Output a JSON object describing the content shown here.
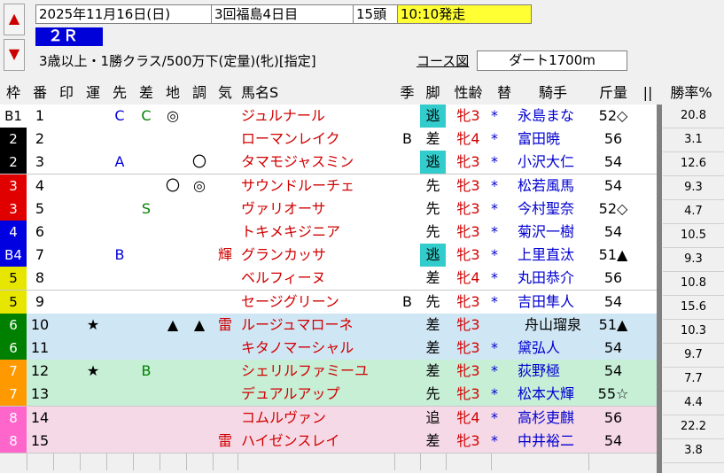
{
  "header": {
    "date": "2025年11月16日(日)",
    "meeting": "3回福島4日目",
    "field_size": "15頭",
    "post_time": "10:10発走",
    "race_number": "２Ｒ",
    "conditions": "3歳以上・1勝クラス/500万下(定量)(牝)[指定]",
    "course_link": "コース図",
    "course": "ダート1700m",
    "up_arrow": "▲",
    "down_arrow": "▼"
  },
  "columns": [
    "枠",
    "番",
    "印",
    "運",
    "先",
    "差",
    "地",
    "調",
    "気",
    "馬名S",
    "季",
    "脚",
    "性齢",
    "替",
    "騎手",
    "斤量",
    "||",
    "勝率%"
  ],
  "colors": {
    "waku": [
      "#ffffff",
      "#000000",
      "#e00000",
      "#0000e0",
      "#e6e600",
      "#008000",
      "#ff9900",
      "#ff66cc"
    ],
    "highlight_cyan": "#33cccc",
    "row_blue": "#cfe6f4",
    "row_green": "#c6efd6",
    "row_pink": "#f6d9e6"
  },
  "horses": [
    {
      "waku": "B1",
      "num": "1",
      "in": "",
      "un": "",
      "saki": "C",
      "sa": "C",
      "chi": "◎",
      "cho": "",
      "ki": "",
      "name": "ジュルナール",
      "kisetsu": "",
      "kyaku": "逃",
      "sexage": "牝3",
      "kae": "*",
      "jockey": "永島まな",
      "weight": "52◇",
      "odds": "20.8"
    },
    {
      "waku": "2",
      "num": "2",
      "in": "",
      "un": "",
      "saki": "",
      "sa": "",
      "chi": "",
      "cho": "",
      "ki": "",
      "name": "ローマンレイク",
      "kisetsu": "B",
      "kyaku": "差",
      "sexage": "牝4",
      "kae": "*",
      "jockey": "富田暁",
      "weight": "56",
      "odds": "3.1"
    },
    {
      "waku": "2",
      "num": "3",
      "in": "",
      "un": "",
      "saki": "A",
      "sa": "",
      "chi": "",
      "cho": "〇",
      "ki": "",
      "name": "タマモジャスミン",
      "kisetsu": "",
      "kyaku": "逃",
      "sexage": "牝3",
      "kae": "*",
      "jockey": "小沢大仁",
      "weight": "54",
      "odds": "12.6"
    },
    {
      "waku": "3",
      "num": "4",
      "in": "",
      "un": "",
      "saki": "",
      "sa": "",
      "chi": "〇",
      "cho": "◎",
      "ki": "",
      "name": "サウンドルーチェ",
      "kisetsu": "",
      "kyaku": "先",
      "sexage": "牝3",
      "kae": "*",
      "jockey": "松若風馬",
      "weight": "54",
      "odds": "9.3"
    },
    {
      "waku": "3",
      "num": "5",
      "in": "",
      "un": "",
      "saki": "",
      "sa": "S",
      "chi": "",
      "cho": "",
      "ki": "",
      "name": "ヴァリオーサ",
      "kisetsu": "",
      "kyaku": "先",
      "sexage": "牝3",
      "kae": "*",
      "jockey": "今村聖奈",
      "weight": "52◇",
      "odds": "4.7"
    },
    {
      "waku": "4",
      "num": "6",
      "in": "",
      "un": "",
      "saki": "",
      "sa": "",
      "chi": "",
      "cho": "",
      "ki": "",
      "name": "トキメキジニア",
      "kisetsu": "",
      "kyaku": "先",
      "sexage": "牝3",
      "kae": "*",
      "jockey": "菊沢一樹",
      "weight": "54",
      "odds": "10.5"
    },
    {
      "waku": "B4",
      "num": "7",
      "in": "",
      "un": "",
      "saki": "B",
      "sa": "",
      "chi": "",
      "cho": "",
      "ki": "輝",
      "name": "グランカッサ",
      "kisetsu": "",
      "kyaku": "逃",
      "sexage": "牝3",
      "kae": "*",
      "jockey": "上里直汰",
      "weight": "51▲",
      "odds": "9.3"
    },
    {
      "waku": "5",
      "num": "8",
      "in": "",
      "un": "",
      "saki": "",
      "sa": "",
      "chi": "",
      "cho": "",
      "ki": "",
      "name": "ベルフィーヌ",
      "kisetsu": "",
      "kyaku": "差",
      "sexage": "牝4",
      "kae": "*",
      "jockey": "丸田恭介",
      "weight": "56",
      "odds": "10.8"
    },
    {
      "waku": "5",
      "num": "9",
      "in": "",
      "un": "",
      "saki": "",
      "sa": "",
      "chi": "",
      "cho": "",
      "ki": "",
      "name": "セージグリーン",
      "kisetsu": "B",
      "kyaku": "先",
      "sexage": "牝3",
      "kae": "*",
      "jockey": "吉田隼人",
      "weight": "54",
      "odds": "15.6"
    },
    {
      "waku": "6",
      "num": "10",
      "in": "",
      "un": "★",
      "saki": "",
      "sa": "",
      "chi": "▲",
      "cho": "▲",
      "ki": "雷",
      "name": "ルージュマローネ",
      "kisetsu": "",
      "kyaku": "差",
      "sexage": "牝3",
      "kae": "",
      "jockey": "舟山瑠泉",
      "weight": "51▲",
      "odds": "10.3"
    },
    {
      "waku": "6",
      "num": "11",
      "in": "",
      "un": "",
      "saki": "",
      "sa": "",
      "chi": "",
      "cho": "",
      "ki": "",
      "name": "キタノマーシャル",
      "kisetsu": "",
      "kyaku": "差",
      "sexage": "牝3",
      "kae": "*",
      "jockey": "黛弘人",
      "weight": "54",
      "odds": "9.7"
    },
    {
      "waku": "7",
      "num": "12",
      "in": "",
      "un": "★",
      "saki": "",
      "sa": "B",
      "chi": "",
      "cho": "",
      "ki": "",
      "name": "シェリルファミーユ",
      "kisetsu": "",
      "kyaku": "差",
      "sexage": "牝3",
      "kae": "*",
      "jockey": "荻野極",
      "weight": "54",
      "odds": "7.7"
    },
    {
      "waku": "7",
      "num": "13",
      "in": "",
      "un": "",
      "saki": "",
      "sa": "",
      "chi": "",
      "cho": "",
      "ki": "",
      "name": "デュアルアップ",
      "kisetsu": "",
      "kyaku": "先",
      "sexage": "牝3",
      "kae": "*",
      "jockey": "松本大輝",
      "weight": "55☆",
      "odds": "4.4"
    },
    {
      "waku": "8",
      "num": "14",
      "in": "",
      "un": "",
      "saki": "",
      "sa": "",
      "chi": "",
      "cho": "",
      "ki": "",
      "name": "コムルヴァン",
      "kisetsu": "",
      "kyaku": "追",
      "sexage": "牝4",
      "kae": "*",
      "jockey": "高杉吏麒",
      "weight": "56",
      "odds": "22.2"
    },
    {
      "waku": "8",
      "num": "15",
      "in": "",
      "un": "",
      "saki": "",
      "sa": "",
      "chi": "",
      "cho": "",
      "ki": "雷",
      "name": "ハイゼンスレイ",
      "kisetsu": "",
      "kyaku": "差",
      "sexage": "牝3",
      "kae": "*",
      "jockey": "中井裕二",
      "weight": "54",
      "odds": "3.8"
    }
  ]
}
